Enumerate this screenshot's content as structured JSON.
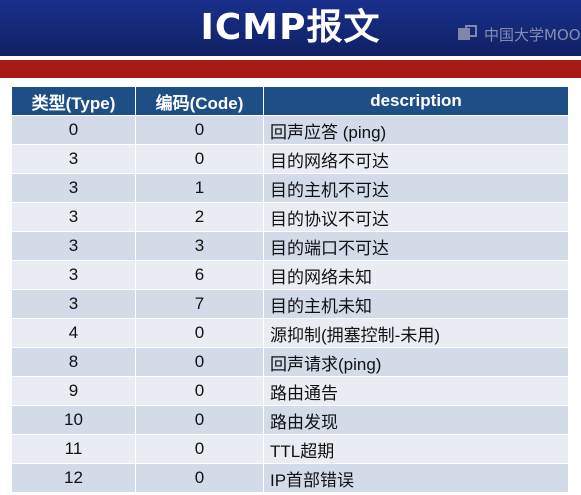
{
  "slide": {
    "title": "ICMP报文",
    "watermark": "中国大学MOOC"
  },
  "table": {
    "headers": [
      "类型(Type)",
      "编码(Code)",
      "description"
    ],
    "rows": [
      {
        "type": "0",
        "code": "0",
        "description": "回声应答 (ping)"
      },
      {
        "type": "3",
        "code": "0",
        "description": "目的网络不可达"
      },
      {
        "type": "3",
        "code": "1",
        "description": "目的主机不可达"
      },
      {
        "type": "3",
        "code": "2",
        "description": "目的协议不可达"
      },
      {
        "type": "3",
        "code": "3",
        "description": "目的端口不可达"
      },
      {
        "type": "3",
        "code": "6",
        "description": "目的网络未知"
      },
      {
        "type": "3",
        "code": "7",
        "description": "目的主机未知"
      },
      {
        "type": "4",
        "code": "0",
        "description": "源抑制(拥塞控制-未用)"
      },
      {
        "type": "8",
        "code": "0",
        "description": "回声请求(ping)"
      },
      {
        "type": "9",
        "code": "0",
        "description": "路由通告"
      },
      {
        "type": "10",
        "code": "0",
        "description": "路由发现"
      },
      {
        "type": "11",
        "code": "0",
        "description": "TTL超期"
      },
      {
        "type": "12",
        "code": "0",
        "description": "IP首部错误"
      }
    ]
  },
  "colors": {
    "title_bar": "#142876",
    "accent_band": "#a61c14",
    "header_bg": "#1d4f86",
    "row_dark": "#d3dbe8",
    "row_light": "#e9edf3"
  }
}
